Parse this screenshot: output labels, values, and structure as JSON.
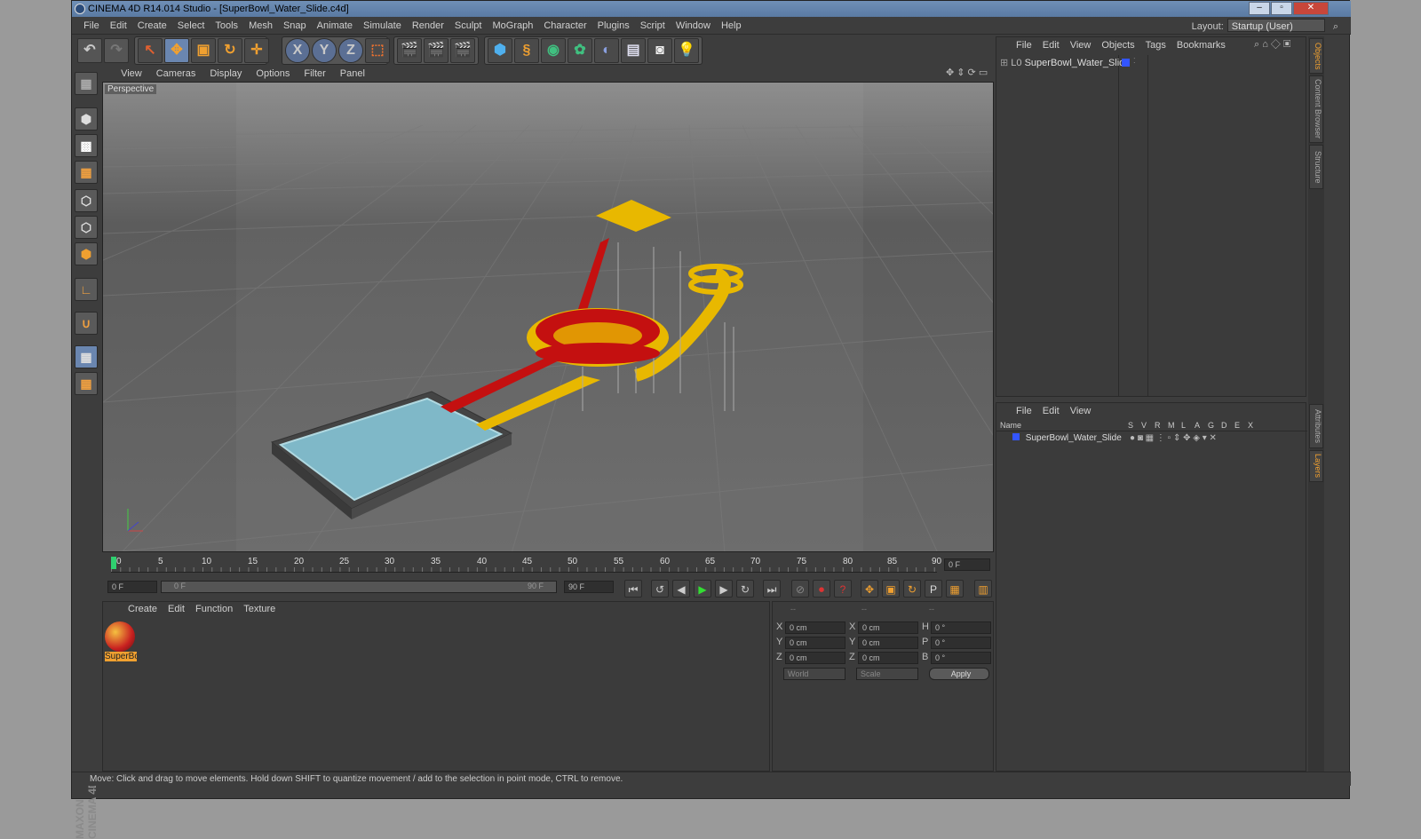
{
  "window": {
    "title": "CINEMA 4D R14.014 Studio - [SuperBowl_Water_Slide.c4d]",
    "controls": [
      "–",
      "▫",
      "✕"
    ]
  },
  "menubar": {
    "items": [
      "File",
      "Edit",
      "Create",
      "Select",
      "Tools",
      "Mesh",
      "Snap",
      "Animate",
      "Simulate",
      "Render",
      "Sculpt",
      "MoGraph",
      "Character",
      "Plugins",
      "Script",
      "Window",
      "Help"
    ],
    "layout_label": "Layout:",
    "layout_value": "Startup (User)"
  },
  "toolbar": {
    "axis_x": "X",
    "axis_y": "Y",
    "axis_z": "Z"
  },
  "viewport": {
    "menu": [
      "View",
      "Cameras",
      "Display",
      "Options",
      "Filter",
      "Panel"
    ],
    "label": "Perspective"
  },
  "timeline": {
    "ticks": [
      "0",
      "5",
      "10",
      "15",
      "20",
      "25",
      "30",
      "35",
      "40",
      "45",
      "50",
      "55",
      "60",
      "65",
      "70",
      "75",
      "80",
      "85",
      "90"
    ],
    "current_frame": "0 F",
    "start_field": "0 F",
    "range_start": "0 F",
    "range_end": "90 F",
    "end_field": "90 F"
  },
  "material_manager": {
    "menu": [
      "Create",
      "Edit",
      "Function",
      "Texture"
    ],
    "materials": [
      {
        "name": "SuperBo"
      }
    ]
  },
  "coordinates": {
    "header": [
      "--",
      "--",
      "--"
    ],
    "rows": [
      {
        "a": "X",
        "av": "0 cm",
        "b": "X",
        "bv": "0 cm",
        "c": "H",
        "cv": "0 °"
      },
      {
        "a": "Y",
        "av": "0 cm",
        "b": "Y",
        "bv": "0 cm",
        "c": "P",
        "cv": "0 °"
      },
      {
        "a": "Z",
        "av": "0 cm",
        "b": "Z",
        "bv": "0 cm",
        "c": "B",
        "cv": "0 °"
      }
    ],
    "mode1": "World",
    "mode2": "Scale",
    "apply": "Apply"
  },
  "object_manager": {
    "menu": [
      "File",
      "Edit",
      "View",
      "Objects",
      "Tags",
      "Bookmarks"
    ],
    "objects": [
      {
        "name": "SuperBowl_Water_Slide",
        "color": "#3355ff"
      }
    ]
  },
  "layer_manager": {
    "menu": [
      "File",
      "Edit",
      "View"
    ],
    "columns": [
      "Name",
      "S",
      "V",
      "R",
      "M",
      "L",
      "A",
      "G",
      "D",
      "E",
      "X"
    ],
    "layers": [
      {
        "name": "SuperBowl_Water_Slide",
        "color": "#3355ff"
      }
    ]
  },
  "side_tabs": [
    "Objects",
    "Content Browser",
    "Structure",
    "Attributes",
    "Layers"
  ],
  "branding": "MAXON CINEMA 4D",
  "statusbar": "Move: Click and drag to move elements. Hold down SHIFT to quantize movement / add to the selection in point mode, CTRL to remove."
}
